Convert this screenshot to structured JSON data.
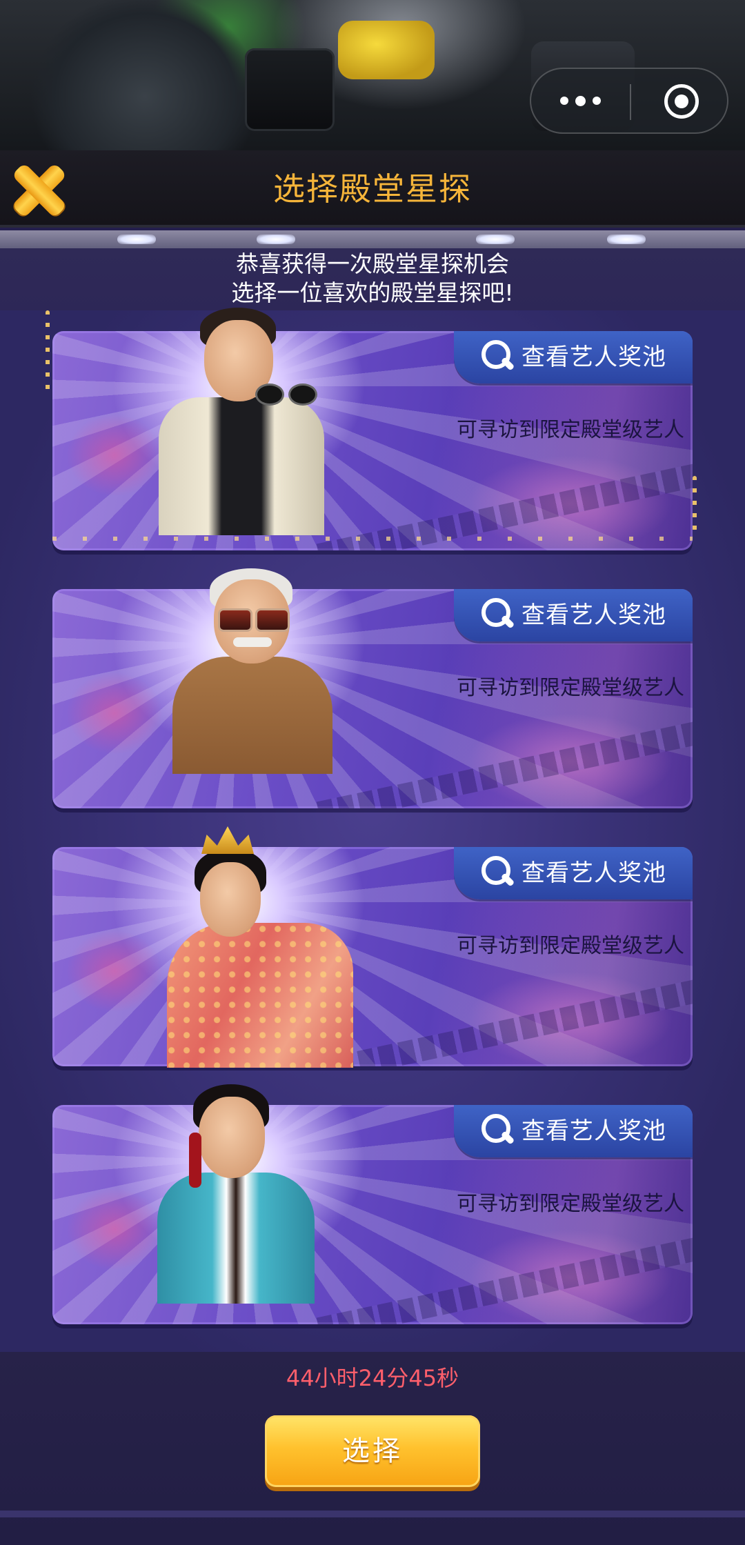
{
  "header": {
    "title": "选择殿堂星探",
    "close_icon": "close-x-icon",
    "menu_icon": "more-dots-icon",
    "target_icon": "target-circle-icon"
  },
  "intro": {
    "line1": "恭喜获得一次殿堂星探机会",
    "line2": "选择一位喜欢的殿堂星探吧!"
  },
  "cards": [
    {
      "pool_label": "查看艺人奖池",
      "description": "可寻访到限定殿堂级艺人"
    },
    {
      "pool_label": "查看艺人奖池",
      "description": "可寻访到限定殿堂级艺人"
    },
    {
      "pool_label": "查看艺人奖池",
      "description": "可寻访到限定殿堂级艺人"
    },
    {
      "pool_label": "查看艺人奖池",
      "description": "可寻访到限定殿堂级艺人"
    }
  ],
  "footer": {
    "countdown": "44小时24分45秒",
    "select_label": "选择"
  },
  "colors": {
    "title_gold": "#f6b53a",
    "countdown_red": "#ff5f6b",
    "button_gold": "#ffc22e",
    "pool_tab_blue": "#3f63c6"
  }
}
